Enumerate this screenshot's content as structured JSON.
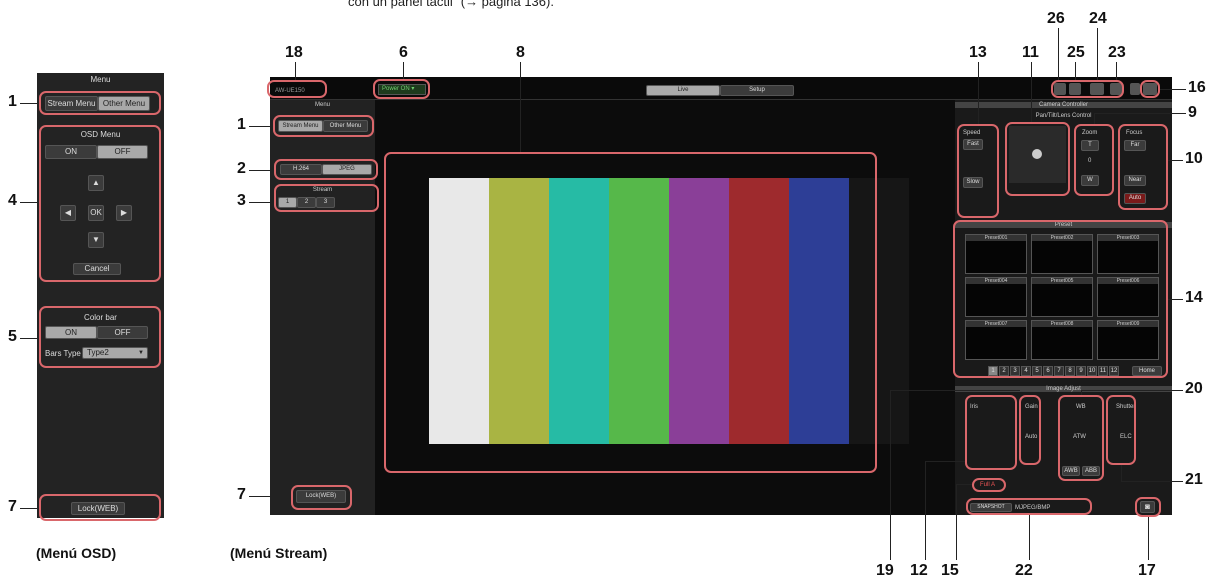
{
  "intro_text": "con un panel táctil” (→ página 136).",
  "osd_panel": {
    "title": "Menu",
    "stream_menu": "Stream Menu",
    "other_menu": "Other Menu",
    "osd_menu_label": "OSD Menu",
    "on": "ON",
    "off": "OFF",
    "ok": "OK",
    "cancel": "Cancel",
    "color_bar_label": "Color bar",
    "bars_type_label": "Bars Type",
    "bars_type_value": "Type2",
    "lock": "Lock(WEB)",
    "caption": "(Menú OSD)"
  },
  "stream_panel": {
    "caption": "(Menú Stream)",
    "device_name": "AW-UE150",
    "power": "Power ON",
    "tab_live": "Live",
    "tab_setup": "Setup",
    "menu_title": "Menu",
    "stream_menu": "Stream Menu",
    "other_menu": "Other Menu",
    "h264": "H.264",
    "jpeg": "JPEG",
    "stream_label": "Stream",
    "streams": [
      "1",
      "2",
      "3"
    ],
    "lock": "Lock(WEB)"
  },
  "camera_controller": {
    "title": "Camera Controller",
    "pan_tilt_title": "Pan/Tilt/Lens Control",
    "speed": "Speed",
    "fast": "Fast",
    "slow": "Slow",
    "zoom": "Zoom",
    "t": "T",
    "w": "W",
    "focus": "Focus",
    "far": "Far",
    "near": "Near",
    "auto": "Auto",
    "zero": "0",
    "preset": "Preset",
    "presets": [
      "Preset001",
      "Preset002",
      "Preset003",
      "Preset004",
      "Preset005",
      "Preset006",
      "Preset007",
      "Preset008",
      "Preset009"
    ],
    "pages": [
      "1",
      "2",
      "3",
      "4",
      "5",
      "6",
      "7",
      "8",
      "9",
      "10",
      "11",
      "12"
    ],
    "home": "Home",
    "image_adjust": "Image Adjust",
    "iris": "Iris",
    "gain": "Gain",
    "gain_auto": "Auto",
    "wb": "WB",
    "atw": "ATW",
    "awb": "AWB",
    "abb": "ABB",
    "shutter": "Shutter",
    "elc": "ELC",
    "full_a": "Full A",
    "snapshot": "SNAPSHOT",
    "snap_info": "MJPEG/BMP"
  },
  "colorbar_colors": [
    "#e8e8e8",
    "#a9b443",
    "#26bba5",
    "#56b84a",
    "#8a3f98",
    "#9e2a2d",
    "#2d3e96",
    "#161616"
  ],
  "callouts": {
    "n1a": "1",
    "n4": "4",
    "n5": "5",
    "n7a": "7",
    "n18": "18",
    "n6": "6",
    "n8": "8",
    "n1b": "1",
    "n2": "2",
    "n3": "3",
    "n7b": "7",
    "n13": "13",
    "n11": "11",
    "n26": "26",
    "n25": "25",
    "n24": "24",
    "n23": "23",
    "n16": "16",
    "n9": "9",
    "n10": "10",
    "n14": "14",
    "n20": "20",
    "n21": "21",
    "n19": "19",
    "n12": "12",
    "n15": "15",
    "n22": "22",
    "n17": "17"
  }
}
